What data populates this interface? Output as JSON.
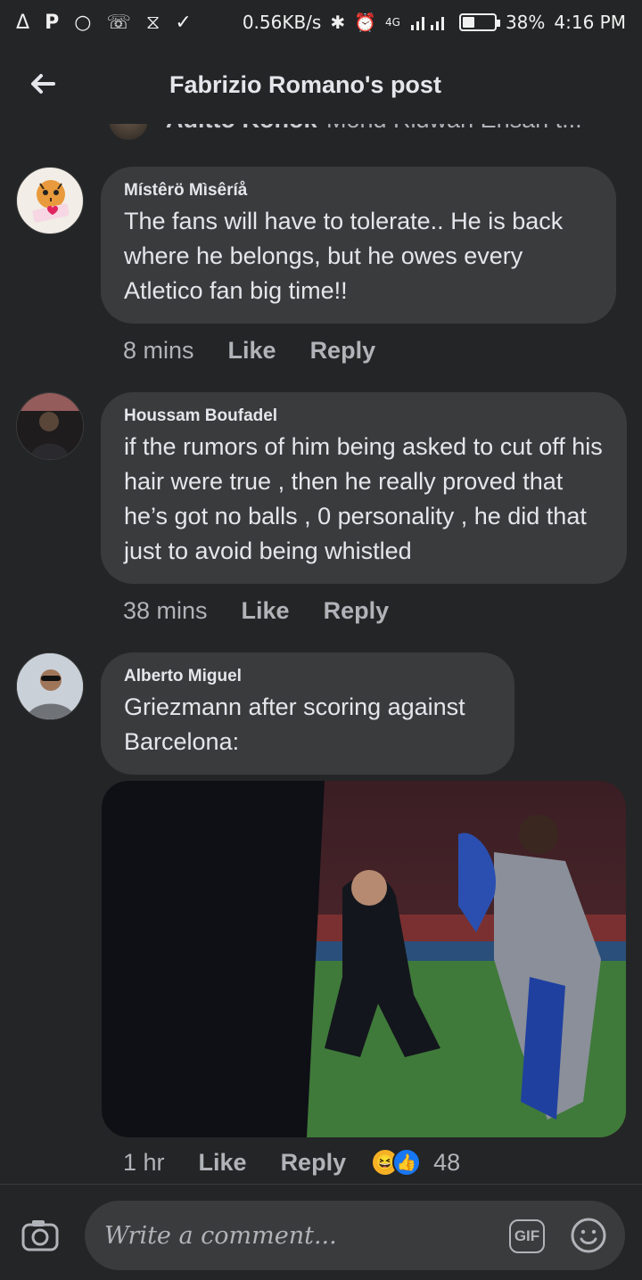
{
  "status_bar": {
    "left_icons": [
      "Δ",
      "P",
      "○",
      "☏",
      "⧖",
      "✓"
    ],
    "left_icon_names": [
      "alert-icon",
      "p-app-icon",
      "messenger-icon",
      "whatsapp-icon",
      "hourglass-icon",
      "check-download-icon"
    ],
    "speed": "0.56KB/s",
    "network": "4G",
    "battery": "38%",
    "battery_level": 0.38,
    "time": "4:16 PM"
  },
  "header": {
    "title": "Fabrizio Romano's post"
  },
  "previous_reply": {
    "name": "Aditto Konok",
    "text": "Mohd Ridwan Ehsan t..."
  },
  "comments": [
    {
      "author": "Místêrö Mìsêríå",
      "text": "The fans will have to tolerate.. He is back where he belongs, but he owes every Atletico fan big time!!",
      "time": "8 mins",
      "like": "Like",
      "reply": "Reply"
    },
    {
      "author": "Houssam Boufadel",
      "text": "if the rumors of him being asked to cut off his hair were true , then he really proved that he’s got no balls , 0 personality , he did that just to avoid being whistled",
      "time": "38 mins",
      "like": "Like",
      "reply": "Reply"
    },
    {
      "author": "Alberto Miguel",
      "text": "Griezmann after scoring against Barcelona:",
      "time": "1 hr",
      "like": "Like",
      "reply": "Reply",
      "reactions": {
        "count": "48",
        "types": [
          "haha",
          "like"
        ]
      }
    }
  ],
  "composer": {
    "placeholder": "Write a comment...",
    "gif_label": "GIF"
  },
  "colors": {
    "background": "#242526",
    "bubble": "#3a3b3c",
    "text": "#e4e6eb",
    "muted": "#b0b3b8",
    "like_blue": "#1877f2"
  }
}
